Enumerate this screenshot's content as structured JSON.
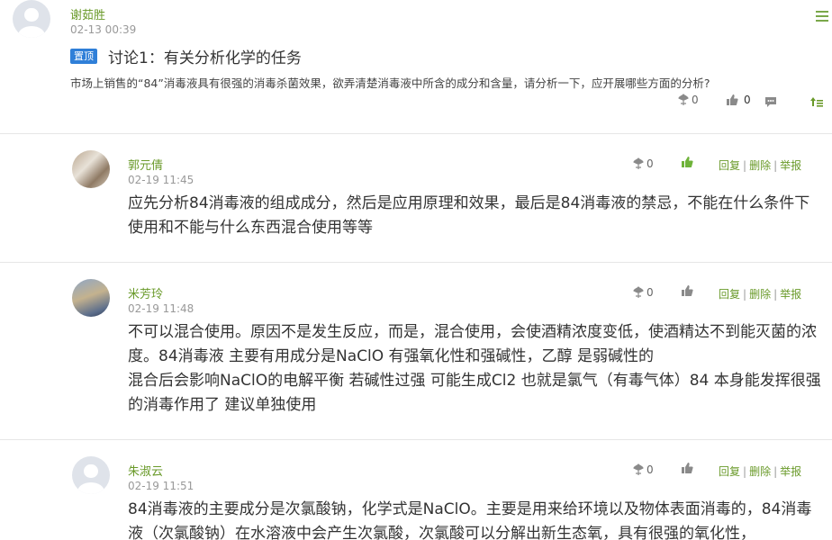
{
  "post": {
    "author": "谢茹胜",
    "time": "02-13 00:39",
    "pin_label": "置顶",
    "title": "讨论1：有关分析化学的任务",
    "body": "市场上销售的“84”消毒液具有很强的消毒杀菌效果，欲弄清楚消毒液中所含的成分和含量，请分析一下，应开展哪些方面的分析?",
    "flower_count": "0",
    "like_count": "0"
  },
  "replies": [
    {
      "author": "郭元倩",
      "time": "02-19 11:45",
      "flower_count": "0",
      "text": "应先分析84消毒液的组成成分，然后是应用原理和效果，最后是84消毒液的禁忌，不能在什么条件下使用和不能与什么东西混合使用等等",
      "actions": [
        "回复",
        "删除",
        "举报"
      ]
    },
    {
      "author": "米芳玲",
      "time": "02-19 11:48",
      "flower_count": "0",
      "text_lines": [
        "不可以混合使用。原因不是发生反应，而是，混合使用，会使酒精浓度变低，使酒精达不到能灭菌的浓度。84消毒液 主要有用成分是NaClO 有强氧化性和强碱性，乙醇 是弱碱性的",
        "混合后会影响NaClO的电解平衡 若碱性过强 可能生成Cl2 也就是氯气（有毒气体）84 本身能发挥很强的消毒作用了 建议单独使用"
      ],
      "actions": [
        "回复",
        "删除",
        "举报"
      ]
    },
    {
      "author": "朱淑云",
      "time": "02-19 11:51",
      "flower_count": "0",
      "text": "84消毒液的主要成分是次氯酸钠，化学式是NaClO。主要是用来给环境以及物体表面消毒的，84消毒液（次氯酸钠）在水溶液中会产生次氯酸，次氯酸可以分解出新生态氧，具有很强的氧化性，",
      "actions": [
        "回复",
        "删除",
        "举报"
      ]
    }
  ],
  "colors": {
    "accent": "#6a9a2a",
    "pin": "#2f7fd8",
    "icon": "#8a8a8a",
    "liked": "#6fb33a"
  },
  "icons": [
    "menu-icon",
    "flower-icon",
    "thumb-up-icon",
    "comment-icon",
    "back-to-top-icon"
  ]
}
